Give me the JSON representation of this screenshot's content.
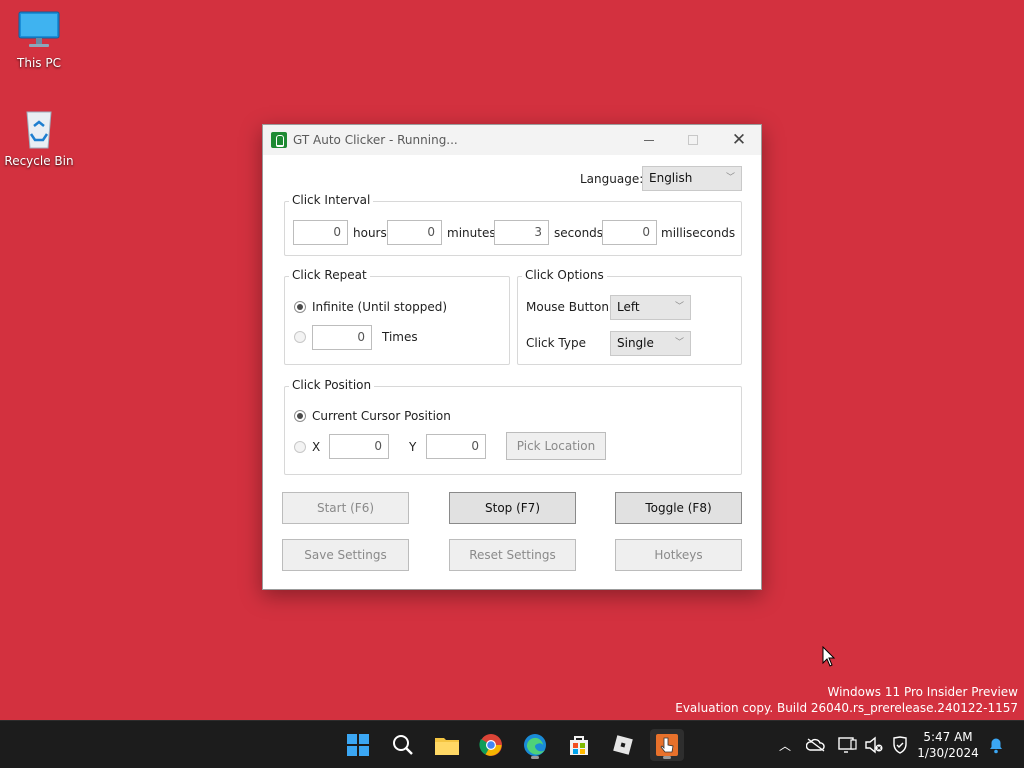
{
  "desktop": {
    "icons": [
      {
        "label": "This PC",
        "icon": "monitor-icon"
      },
      {
        "label": "Recycle Bin",
        "icon": "recycle-bin-icon"
      }
    ],
    "background_color": "#d3313f",
    "watermark": {
      "line1": "Windows 11 Pro Insider Preview",
      "line2": "Evaluation copy. Build 26040.rs_prerelease.240122-1157"
    }
  },
  "window": {
    "title": "GT Auto Clicker - Running...",
    "language_label": "Language:",
    "language_value": "English",
    "click_interval": {
      "title": "Click Interval",
      "hours": {
        "value": "0",
        "label": "hours"
      },
      "minutes": {
        "value": "0",
        "label": "minutes"
      },
      "seconds": {
        "value": "3",
        "label": "seconds"
      },
      "milliseconds": {
        "value": "0",
        "label": "milliseconds"
      }
    },
    "click_repeat": {
      "title": "Click Repeat",
      "infinite_label": "Infinite (Until stopped)",
      "times_value": "0",
      "times_label": "Times",
      "selected": "infinite"
    },
    "click_options": {
      "title": "Click Options",
      "mouse_button_label": "Mouse Button",
      "mouse_button_value": "Left",
      "click_type_label": "Click Type",
      "click_type_value": "Single"
    },
    "click_position": {
      "title": "Click Position",
      "current_label": "Current Cursor Position",
      "x_label": "X",
      "x_value": "0",
      "y_label": "Y",
      "y_value": "0",
      "pick_label": "Pick Location",
      "selected": "current"
    },
    "buttons": {
      "start": "Start (F6)",
      "stop": "Stop (F7)",
      "toggle": "Toggle (F8)",
      "save": "Save Settings",
      "reset": "Reset Settings",
      "hotkeys": "Hotkeys"
    }
  },
  "taskbar": {
    "apps": [
      "start-icon",
      "search-icon",
      "file-explorer-icon",
      "chrome-icon",
      "edge-icon",
      "store-icon",
      "roblox-icon",
      "auto-clicker-icon"
    ],
    "clock": {
      "time": "5:47 AM",
      "date": "1/30/2024"
    }
  }
}
